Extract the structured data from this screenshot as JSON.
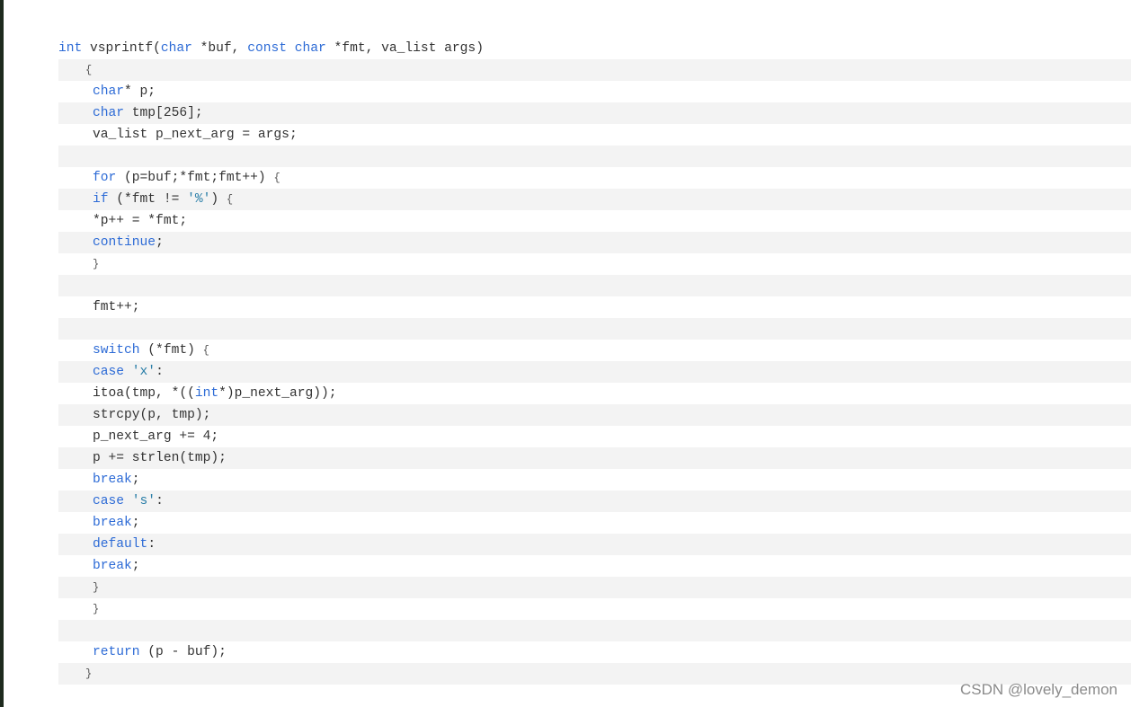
{
  "code": {
    "language": "c",
    "lines": [
      {
        "indent": 0,
        "tokens": [
          {
            "t": "int",
            "c": "kw"
          },
          {
            "t": " vsprintf(",
            "c": "plain"
          },
          {
            "t": "char",
            "c": "kw"
          },
          {
            "t": " *buf, ",
            "c": "plain"
          },
          {
            "t": "const",
            "c": "kw"
          },
          {
            "t": " ",
            "c": "plain"
          },
          {
            "t": "char",
            "c": "kw"
          },
          {
            "t": " *fmt, va_list args)",
            "c": "plain"
          }
        ]
      },
      {
        "indent": 1,
        "tokens": [
          {
            "t": "{",
            "c": "brace"
          }
        ]
      },
      {
        "indent": 2,
        "tokens": [
          {
            "t": "char",
            "c": "kw"
          },
          {
            "t": "* p;",
            "c": "plain"
          }
        ]
      },
      {
        "indent": 2,
        "tokens": [
          {
            "t": "char",
            "c": "kw"
          },
          {
            "t": " tmp[256];",
            "c": "plain"
          }
        ]
      },
      {
        "indent": 2,
        "tokens": [
          {
            "t": "va_list p_next_arg = args;",
            "c": "plain"
          }
        ]
      },
      {
        "indent": 2,
        "tokens": []
      },
      {
        "indent": 2,
        "tokens": [
          {
            "t": "for",
            "c": "kw"
          },
          {
            "t": " (p=buf;*fmt;fmt++) ",
            "c": "plain"
          },
          {
            "t": "{",
            "c": "brace"
          }
        ]
      },
      {
        "indent": 2,
        "tokens": [
          {
            "t": "if",
            "c": "kw"
          },
          {
            "t": " (*fmt != ",
            "c": "plain"
          },
          {
            "t": "'%'",
            "c": "str"
          },
          {
            "t": ") ",
            "c": "plain"
          },
          {
            "t": "{",
            "c": "brace"
          }
        ]
      },
      {
        "indent": 2,
        "tokens": [
          {
            "t": "*p++ = *fmt;",
            "c": "plain"
          }
        ]
      },
      {
        "indent": 2,
        "tokens": [
          {
            "t": "continue",
            "c": "kw"
          },
          {
            "t": ";",
            "c": "plain"
          }
        ]
      },
      {
        "indent": 2,
        "tokens": [
          {
            "t": "}",
            "c": "brace"
          }
        ]
      },
      {
        "indent": 2,
        "tokens": []
      },
      {
        "indent": 2,
        "tokens": [
          {
            "t": "fmt++;",
            "c": "plain"
          }
        ]
      },
      {
        "indent": 2,
        "tokens": []
      },
      {
        "indent": 2,
        "tokens": [
          {
            "t": "switch",
            "c": "kw"
          },
          {
            "t": " (*fmt) ",
            "c": "plain"
          },
          {
            "t": "{",
            "c": "brace"
          }
        ]
      },
      {
        "indent": 2,
        "tokens": [
          {
            "t": "case",
            "c": "kw"
          },
          {
            "t": " ",
            "c": "plain"
          },
          {
            "t": "'x'",
            "c": "str"
          },
          {
            "t": ":",
            "c": "plain"
          }
        ]
      },
      {
        "indent": 2,
        "tokens": [
          {
            "t": "itoa(tmp, *((",
            "c": "plain"
          },
          {
            "t": "int",
            "c": "kw"
          },
          {
            "t": "*)p_next_arg));",
            "c": "plain"
          }
        ]
      },
      {
        "indent": 2,
        "tokens": [
          {
            "t": "strcpy(p, tmp);",
            "c": "plain"
          }
        ]
      },
      {
        "indent": 2,
        "tokens": [
          {
            "t": "p_next_arg += 4;",
            "c": "plain"
          }
        ]
      },
      {
        "indent": 2,
        "tokens": [
          {
            "t": "p += strlen(tmp);",
            "c": "plain"
          }
        ]
      },
      {
        "indent": 2,
        "tokens": [
          {
            "t": "break",
            "c": "kw"
          },
          {
            "t": ";",
            "c": "plain"
          }
        ]
      },
      {
        "indent": 2,
        "tokens": [
          {
            "t": "case",
            "c": "kw"
          },
          {
            "t": " ",
            "c": "plain"
          },
          {
            "t": "'s'",
            "c": "str"
          },
          {
            "t": ":",
            "c": "plain"
          }
        ]
      },
      {
        "indent": 2,
        "tokens": [
          {
            "t": "break",
            "c": "kw"
          },
          {
            "t": ";",
            "c": "plain"
          }
        ]
      },
      {
        "indent": 2,
        "tokens": [
          {
            "t": "default",
            "c": "kw"
          },
          {
            "t": ":",
            "c": "plain"
          }
        ]
      },
      {
        "indent": 2,
        "tokens": [
          {
            "t": "break",
            "c": "kw"
          },
          {
            "t": ";",
            "c": "plain"
          }
        ]
      },
      {
        "indent": 2,
        "tokens": [
          {
            "t": "}",
            "c": "brace"
          }
        ]
      },
      {
        "indent": 2,
        "tokens": [
          {
            "t": "}",
            "c": "brace"
          }
        ]
      },
      {
        "indent": 2,
        "tokens": []
      },
      {
        "indent": 2,
        "tokens": [
          {
            "t": "return",
            "c": "kw"
          },
          {
            "t": " (p - buf);",
            "c": "plain"
          }
        ]
      },
      {
        "indent": 1,
        "tokens": [
          {
            "t": "}",
            "c": "brace"
          }
        ]
      }
    ]
  },
  "watermark": {
    "text": "CSDN @lovely_demon"
  },
  "colors": {
    "keyword": "#2d6bd6",
    "string": "#2a7ea8",
    "text": "#333333",
    "stripe": "#f3f3f3",
    "background": "#ffffff"
  }
}
